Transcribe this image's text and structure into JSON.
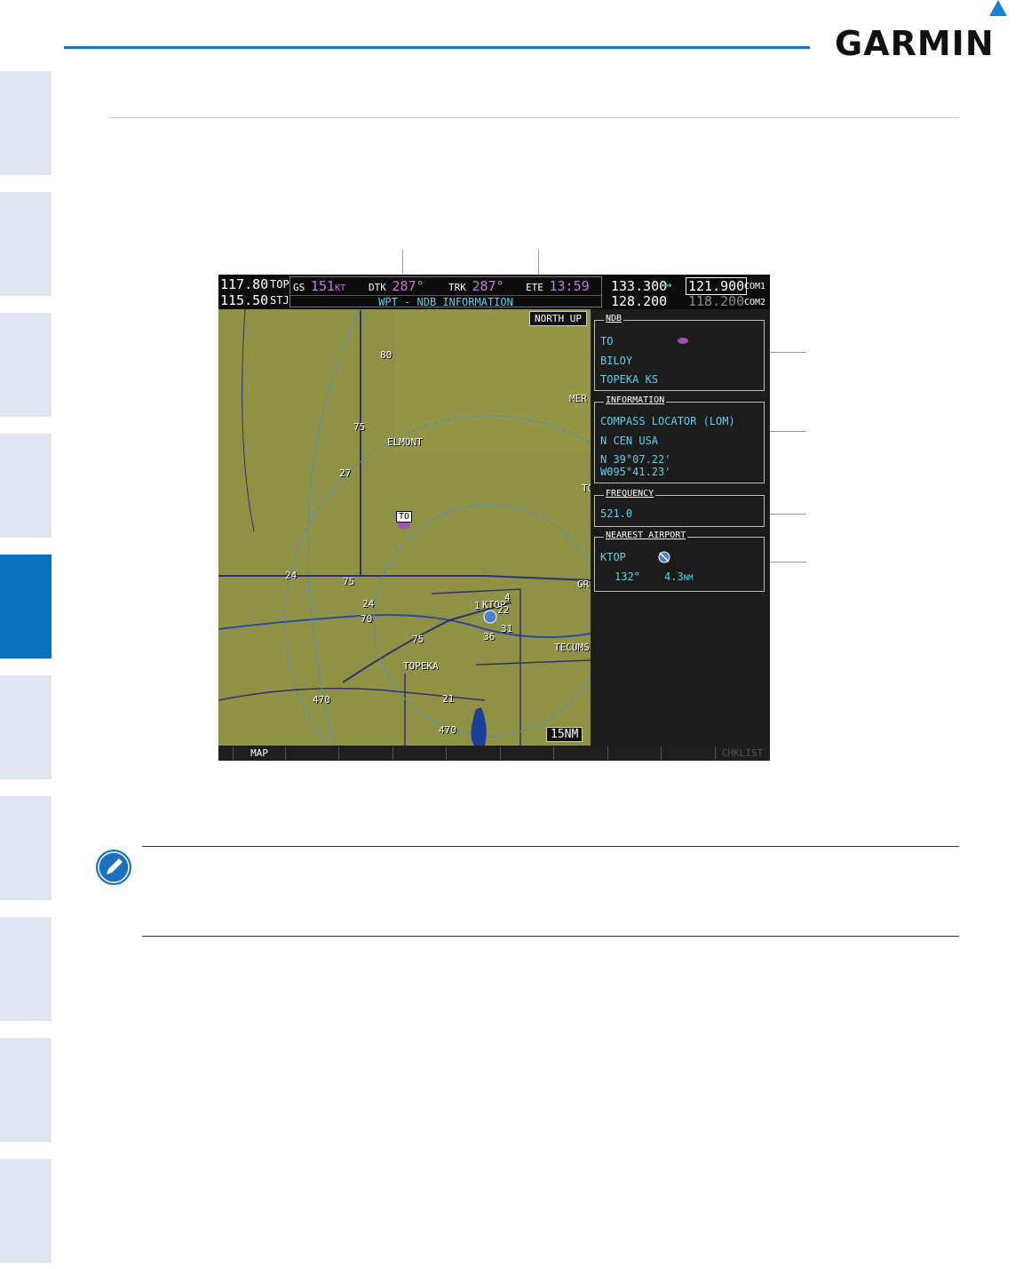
{
  "header": {
    "logo_text": "GARMIN",
    "accent_color": "#1d6fc0"
  },
  "nav_tabs": {
    "count": 10,
    "active_index": 4
  },
  "display": {
    "nav1": {
      "active": "117.80",
      "id": "TOP"
    },
    "nav2": {
      "active": "115.50",
      "id": "STJ"
    },
    "gs": {
      "label": "GS",
      "value": "151",
      "unit": "KT"
    },
    "dtk": {
      "label": "DTK",
      "value": "287°"
    },
    "trk": {
      "label": "TRK",
      "value": "287°"
    },
    "ete": {
      "label": "ETE",
      "value": "13:59"
    },
    "page_title": "WPT - NDB INFORMATION",
    "com1": {
      "active": "133.300",
      "standby": "121.900",
      "label": "COM1"
    },
    "com2": {
      "active": "128.200",
      "standby": "118.200",
      "label": "COM2"
    },
    "com_arrow": "↔",
    "map": {
      "orientation": "NORTH UP",
      "range": "15NM",
      "labels": [
        "80",
        "75",
        "ELMONT",
        "27",
        "TO",
        "24",
        "75",
        "24",
        "70",
        "75",
        "TOPEKA",
        "21",
        "470",
        "470",
        "TECUMS",
        "GR",
        "MER",
        "TO",
        "1",
        "KTOP",
        "4",
        "22",
        "31",
        "36"
      ]
    },
    "ndb_box": {
      "title": "NDB",
      "ident": "TO",
      "name": "BILOY",
      "city": "TOPEKA KS"
    },
    "info_box": {
      "title": "INFORMATION",
      "type": "COMPASS LOCATOR (LOM)",
      "region": "N CEN USA",
      "lat": "N 39°07.22'",
      "lon": "W095°41.23'"
    },
    "freq_box": {
      "title": "FREQUENCY",
      "value": "521.0"
    },
    "nearest_box": {
      "title": "NEAREST AIRPORT",
      "ident": "KTOP",
      "bearing": "132°",
      "distance": "4.3",
      "distance_unit": "NM"
    },
    "softkeys": [
      "",
      "MAP",
      "",
      "",
      "",
      "",
      "",
      "",
      "",
      "",
      "CHKLIST"
    ]
  }
}
